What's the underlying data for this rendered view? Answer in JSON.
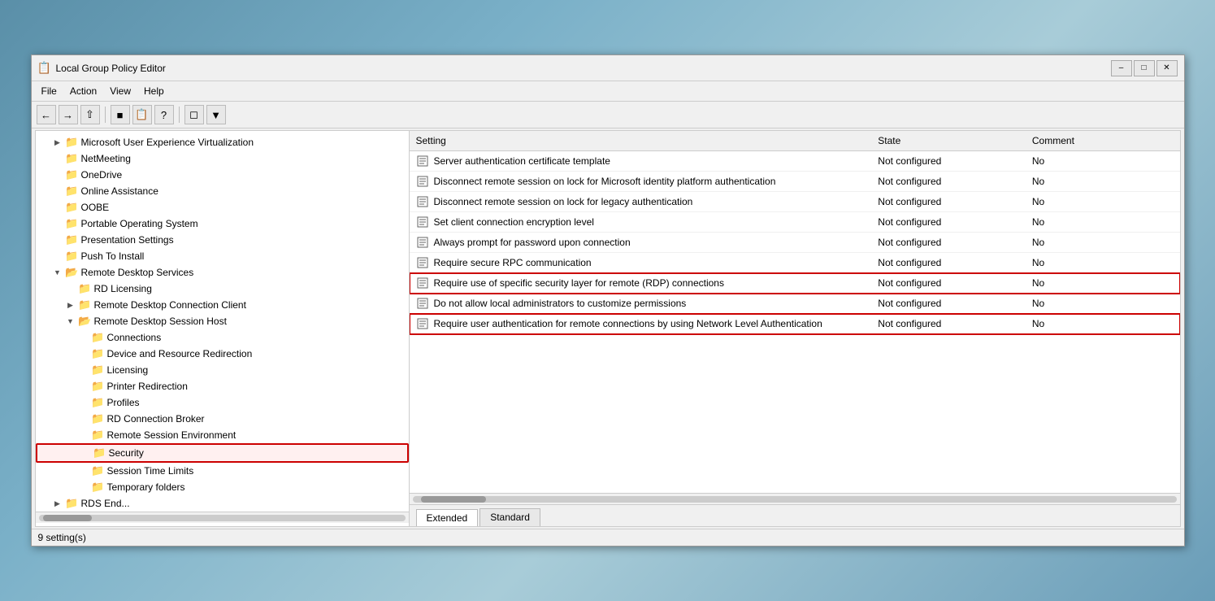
{
  "window": {
    "title": "Local Group Policy Editor",
    "minimize": "–",
    "restore": "□",
    "close": "✕"
  },
  "menu": {
    "items": [
      "File",
      "Action",
      "View",
      "Help"
    ]
  },
  "toolbar": {
    "buttons": [
      "←",
      "→",
      "⬆",
      "▦",
      "📋",
      "?",
      "▣",
      "▼"
    ]
  },
  "tree": {
    "items": [
      {
        "id": "ms-user-exp",
        "label": "Microsoft User Experience Virtualization",
        "indent": 1,
        "expanded": false,
        "hasArrow": true
      },
      {
        "id": "netmeeting",
        "label": "NetMeeting",
        "indent": 1,
        "expanded": false,
        "hasArrow": false
      },
      {
        "id": "onedrive",
        "label": "OneDrive",
        "indent": 1,
        "expanded": false,
        "hasArrow": false
      },
      {
        "id": "online-assistance",
        "label": "Online Assistance",
        "indent": 1,
        "expanded": false,
        "hasArrow": false
      },
      {
        "id": "oobe",
        "label": "OOBE",
        "indent": 1,
        "expanded": false,
        "hasArrow": false
      },
      {
        "id": "portable-os",
        "label": "Portable Operating System",
        "indent": 1,
        "expanded": false,
        "hasArrow": false
      },
      {
        "id": "presentation",
        "label": "Presentation Settings",
        "indent": 1,
        "expanded": false,
        "hasArrow": false
      },
      {
        "id": "push-to-install",
        "label": "Push To Install",
        "indent": 1,
        "expanded": false,
        "hasArrow": false
      },
      {
        "id": "remote-desktop",
        "label": "Remote Desktop Services",
        "indent": 1,
        "expanded": true,
        "hasArrow": true
      },
      {
        "id": "rd-licensing",
        "label": "RD Licensing",
        "indent": 2,
        "expanded": false,
        "hasArrow": false
      },
      {
        "id": "rdcc",
        "label": "Remote Desktop Connection Client",
        "indent": 2,
        "expanded": false,
        "hasArrow": true
      },
      {
        "id": "rdsh",
        "label": "Remote Desktop Session Host",
        "indent": 2,
        "expanded": true,
        "hasArrow": true
      },
      {
        "id": "connections",
        "label": "Connections",
        "indent": 3,
        "expanded": false,
        "hasArrow": false
      },
      {
        "id": "device-redirection",
        "label": "Device and Resource Redirection",
        "indent": 3,
        "expanded": false,
        "hasArrow": false
      },
      {
        "id": "licensing",
        "label": "Licensing",
        "indent": 3,
        "expanded": false,
        "hasArrow": false
      },
      {
        "id": "printer-redirection",
        "label": "Printer Redirection",
        "indent": 3,
        "expanded": false,
        "hasArrow": false
      },
      {
        "id": "profiles",
        "label": "Profiles",
        "indent": 3,
        "expanded": false,
        "hasArrow": false
      },
      {
        "id": "rd-connection-broker",
        "label": "RD Connection Broker",
        "indent": 3,
        "expanded": false,
        "hasArrow": false
      },
      {
        "id": "remote-session-env",
        "label": "Remote Session Environment",
        "indent": 3,
        "expanded": false,
        "hasArrow": false
      },
      {
        "id": "security",
        "label": "Security",
        "indent": 3,
        "expanded": false,
        "hasArrow": false,
        "selected": true
      },
      {
        "id": "session-time-limits",
        "label": "Session Time Limits",
        "indent": 3,
        "expanded": false,
        "hasArrow": false
      },
      {
        "id": "temp-folders",
        "label": "Temporary folders",
        "indent": 3,
        "expanded": false,
        "hasArrow": false
      },
      {
        "id": "rds-end",
        "label": "RDS End...",
        "indent": 1,
        "expanded": false,
        "hasArrow": true
      }
    ]
  },
  "table": {
    "columns": [
      {
        "id": "setting",
        "label": "Setting",
        "width": "60%"
      },
      {
        "id": "state",
        "label": "State",
        "width": "20%"
      },
      {
        "id": "comment",
        "label": "Comment",
        "width": "20%"
      }
    ],
    "rows": [
      {
        "setting": "Server authentication certificate template",
        "state": "Not configured",
        "comment": "No",
        "highlighted": false
      },
      {
        "setting": "Disconnect remote session on lock for Microsoft identity platform authentication",
        "state": "Not configured",
        "comment": "No",
        "highlighted": false
      },
      {
        "setting": "Disconnect remote session on lock for legacy authentication",
        "state": "Not configured",
        "comment": "No",
        "highlighted": false
      },
      {
        "setting": "Set client connection encryption level",
        "state": "Not configured",
        "comment": "No",
        "highlighted": false
      },
      {
        "setting": "Always prompt for password upon connection",
        "state": "Not configured",
        "comment": "No",
        "highlighted": false
      },
      {
        "setting": "Require secure RPC communication",
        "state": "Not configured",
        "comment": "No",
        "highlighted": false
      },
      {
        "setting": "Require use of specific security layer for remote (RDP) connections",
        "state": "Not configured",
        "comment": "No",
        "highlighted": true
      },
      {
        "setting": "Do not allow local administrators to customize permissions",
        "state": "Not configured",
        "comment": "No",
        "highlighted": false
      },
      {
        "setting": "Require user authentication for remote connections by using Network Level Authentication",
        "state": "Not configured",
        "comment": "No",
        "highlighted": true
      }
    ]
  },
  "tabs": [
    {
      "label": "Extended",
      "active": true
    },
    {
      "label": "Standard",
      "active": false
    }
  ],
  "status": {
    "text": "9 setting(s)"
  }
}
